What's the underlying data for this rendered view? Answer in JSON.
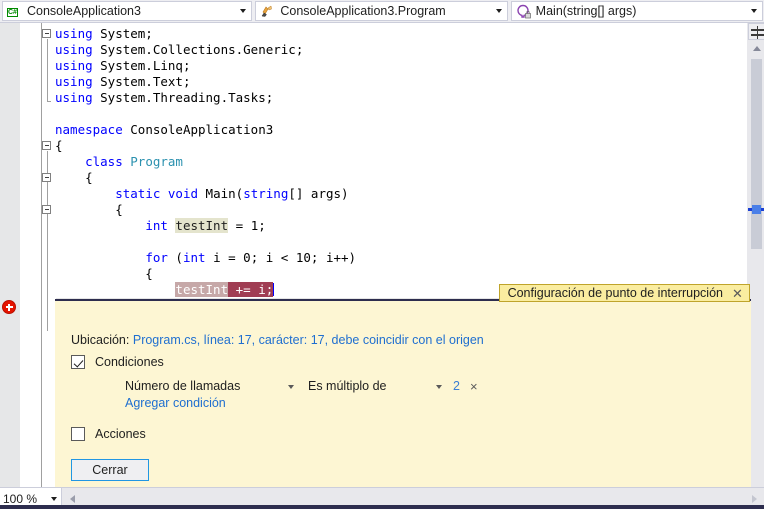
{
  "navbar": {
    "project_selector": {
      "label": "ConsoleApplication3",
      "icon": "csharp-project-icon",
      "icon_text": "C#"
    },
    "type_selector": {
      "label": "ConsoleApplication3.Program",
      "icon": "class-icon"
    },
    "member_selector": {
      "label": "Main(string[] args)",
      "icon": "method-private-icon"
    }
  },
  "editor": {
    "lines": [
      [
        {
          "t": "using ",
          "c": "kw"
        },
        {
          "t": "System;",
          "c": "pln"
        }
      ],
      [
        {
          "t": "using ",
          "c": "kw"
        },
        {
          "t": "System.Collections.Generic;",
          "c": "pln"
        }
      ],
      [
        {
          "t": "using ",
          "c": "kw"
        },
        {
          "t": "System.Linq;",
          "c": "pln"
        }
      ],
      [
        {
          "t": "using ",
          "c": "kw"
        },
        {
          "t": "System.Text;",
          "c": "pln"
        }
      ],
      [
        {
          "t": "using ",
          "c": "kw"
        },
        {
          "t": "System.Threading.Tasks;",
          "c": "pln"
        }
      ],
      [],
      [
        {
          "t": "namespace ",
          "c": "kw"
        },
        {
          "t": "ConsoleApplication3",
          "c": "pln"
        }
      ],
      [
        {
          "t": "{",
          "c": "pln"
        }
      ],
      [
        {
          "t": "    ",
          "c": "pln"
        },
        {
          "t": "class ",
          "c": "kw"
        },
        {
          "t": "Program",
          "c": "typ"
        }
      ],
      [
        {
          "t": "    {",
          "c": "pln"
        }
      ],
      [
        {
          "t": "        ",
          "c": "pln"
        },
        {
          "t": "static ",
          "c": "kw"
        },
        {
          "t": "void ",
          "c": "kw"
        },
        {
          "t": "Main(",
          "c": "pln"
        },
        {
          "t": "string",
          "c": "kw"
        },
        {
          "t": "[] args)",
          "c": "pln"
        }
      ],
      [
        {
          "t": "        {",
          "c": "pln"
        }
      ],
      [
        {
          "t": "            ",
          "c": "pln"
        },
        {
          "t": "int ",
          "c": "kw"
        },
        {
          "t": "testInt",
          "c": "hl-ref"
        },
        {
          "t": " = ",
          "c": "pln"
        },
        {
          "t": "1",
          "c": "num"
        },
        {
          "t": ";",
          "c": "pln"
        }
      ],
      [],
      [
        {
          "t": "            ",
          "c": "pln"
        },
        {
          "t": "for ",
          "c": "kw"
        },
        {
          "t": "(",
          "c": "pln"
        },
        {
          "t": "int ",
          "c": "kw"
        },
        {
          "t": "i = ",
          "c": "pln"
        },
        {
          "t": "0",
          "c": "num"
        },
        {
          "t": "; i < ",
          "c": "pln"
        },
        {
          "t": "10",
          "c": "num"
        },
        {
          "t": "; i++)",
          "c": "pln"
        }
      ],
      [
        {
          "t": "            {",
          "c": "pln"
        }
      ],
      [
        {
          "t": "                ",
          "c": "pln"
        },
        {
          "t": "testInt",
          "c": "bp-sel-a"
        },
        {
          "t": " += i;",
          "c": "bp-sel-b"
        }
      ]
    ],
    "breakpoint_glyph": "conditional-breakpoint-icon"
  },
  "peek_window": {
    "title": "Configuración de punto de interrupción",
    "close_icon": "close-icon",
    "location_label": "Ubicación:",
    "location_value": "Program.cs, línea: 17, carácter: 17, debe coincidir con el origen",
    "conditions": {
      "checkbox_label": "Condiciones",
      "checked": true,
      "type_dropdown": "Número de llamadas",
      "operator_dropdown": "Es múltiplo de",
      "value": "2",
      "remove_icon": "×",
      "add_link": "Agregar condición"
    },
    "actions": {
      "checkbox_label": "Acciones",
      "checked": false
    },
    "close_button": "Cerrar"
  },
  "statusbar": {
    "zoom": "100 %",
    "zoom_arrow_icon": "chevron-down-icon",
    "scroll_left_icon": "triangle-left-icon",
    "scroll_right_icon": "triangle-right-icon"
  },
  "scrollbar": {
    "split_icon": "split-view-icon",
    "up_icon": "triangle-up-icon"
  },
  "colors": {
    "peek_bg": "#fdf6d3",
    "peek_title_bg": "#faeda0",
    "link": "#1f6fd0",
    "keyword": "#0000ff",
    "type": "#2b91af",
    "breakpoint_red": "#e51400",
    "accent_border": "#2d2d4e"
  }
}
